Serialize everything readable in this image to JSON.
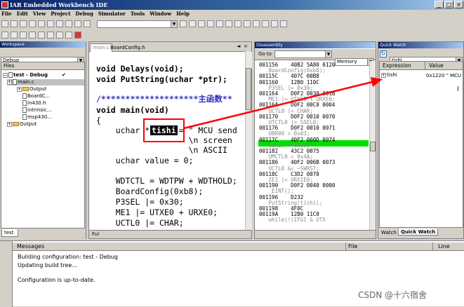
{
  "window": {
    "title": "IAR Embedded Workbench IDE",
    "min": "_",
    "max": "□",
    "close": "×"
  },
  "menu": [
    "File",
    "Edit",
    "View",
    "Project",
    "Debug",
    "Simulator",
    "Tools",
    "Window",
    "Help"
  ],
  "workspace": {
    "title": "Workspace",
    "config": "Debug",
    "files_header": "Files",
    "tree": [
      {
        "label": "test - Debug",
        "check": "✔"
      },
      {
        "label": "main.c"
      },
      {
        "label": "Output"
      },
      {
        "label": "BoardC..."
      },
      {
        "label": "in430.h"
      },
      {
        "label": "intrinsic..."
      },
      {
        "label": "msp430..."
      },
      {
        "label": "Output"
      }
    ],
    "tab": "test"
  },
  "editor": {
    "tabs": [
      "main.c",
      "BoardConfig.h"
    ],
    "lines": [
      "void Delays(void);",
      "void PutString(uchar *ptr);",
      "",
      "/********************主函数**",
      "void main(void)",
      "{",
      "    uchar *tishi = \" MCU send",
      "                   \\n screen",
      "                   \\n ASCII",
      "    uchar value = 0;",
      "",
      "    WDTCTL = WDTPW + WDTHOLD;",
      "    BoardConfig(0xb8);",
      "    P3SEL |= 0x30;",
      "    ME1 |= UTXE0 + URXE0;",
      "    UCTL0 |= CHAR;"
    ],
    "highlight_var": "tishi",
    "bottom_tab": "Ful"
  },
  "disassembly": {
    "title": "Disassembly",
    "goto_label": "Go to",
    "memory_label": "Memory",
    "lines": [
      {
        "t": "001156    40B2 5A80 0120",
        "g": false
      },
      {
        "t": "   BoardConfig(0xb8);",
        "g": true
      },
      {
        "t": "00115C    407C 00B8",
        "g": false
      },
      {
        "t": "001160    12B0 110C",
        "g": false
      },
      {
        "t": "   P3SEL |= 0x30;",
        "g": true
      },
      {
        "t": "001164    D0F2 0030 001B",
        "g": false
      },
      {
        "t": "   ME1 |= UTXE0 + URXE0;",
        "g": true
      },
      {
        "t": "00116A    D0F2 00C0 0004",
        "g": false
      },
      {
        "t": "   UCTL0 |= CHAR;",
        "g": true
      },
      {
        "t": "001170    D0F2 0010 0070",
        "g": false
      },
      {
        "t": "   UTCTL0 |= SSEL0;",
        "g": true
      },
      {
        "t": "001176    D0F2 0010 0071",
        "g": false
      },
      {
        "t": "   UBR00 = 0x03;",
        "g": true
      },
      {
        "t": "00117C    40F2 000D 0074",
        "g": false
      },
      {
        "t": "   UBR10 = 0x00;",
        "g": true
      },
      {
        "t": "001182    43C2 0075",
        "g": false
      },
      {
        "t": "   UMCTL0 = 0x4A;",
        "g": true
      },
      {
        "t": "001186    40F2 006B 0073",
        "g": false
      },
      {
        "t": "   UCTL0 &= ~SWRST;",
        "g": true
      },
      {
        "t": "00118C    C3D2 0070",
        "g": false
      },
      {
        "t": "   IE1 |= URXIE0;",
        "g": true
      },
      {
        "t": "001190    D0F2 0040 0000",
        "g": false
      },
      {
        "t": "   _EINT();",
        "g": true
      },
      {
        "t": "001196    D232",
        "g": false
      },
      {
        "t": "   PutString(tishi);",
        "g": true
      },
      {
        "t": "001198    4F0C",
        "g": false
      },
      {
        "t": "00119A    12B0 11C0",
        "g": false
      },
      {
        "t": "   while(!(IFG1 & UTX",
        "g": true
      }
    ]
  },
  "quickwatch": {
    "title": "Quick Watch",
    "input": "tishi",
    "col_expression": "Expression",
    "col_value": "Value",
    "row_expr": "tishi",
    "row_value": "0x1220 \" MCU",
    "tabs": [
      "Watch",
      "Quick Watch"
    ]
  },
  "messages": {
    "col_messages": "Messages",
    "col_file": "File",
    "col_line": "Line",
    "lines": [
      "Building configuration: test - Debug",
      "Updating build tree...",
      "",
      "Configuration is up-to-date."
    ]
  },
  "watermark": "CSDN @十六宿舍",
  "colors": {
    "title_start": "#0a246a",
    "highlight_line": "#00dd00",
    "annotation": "#ff0000",
    "code_comment": "#3030c0"
  }
}
